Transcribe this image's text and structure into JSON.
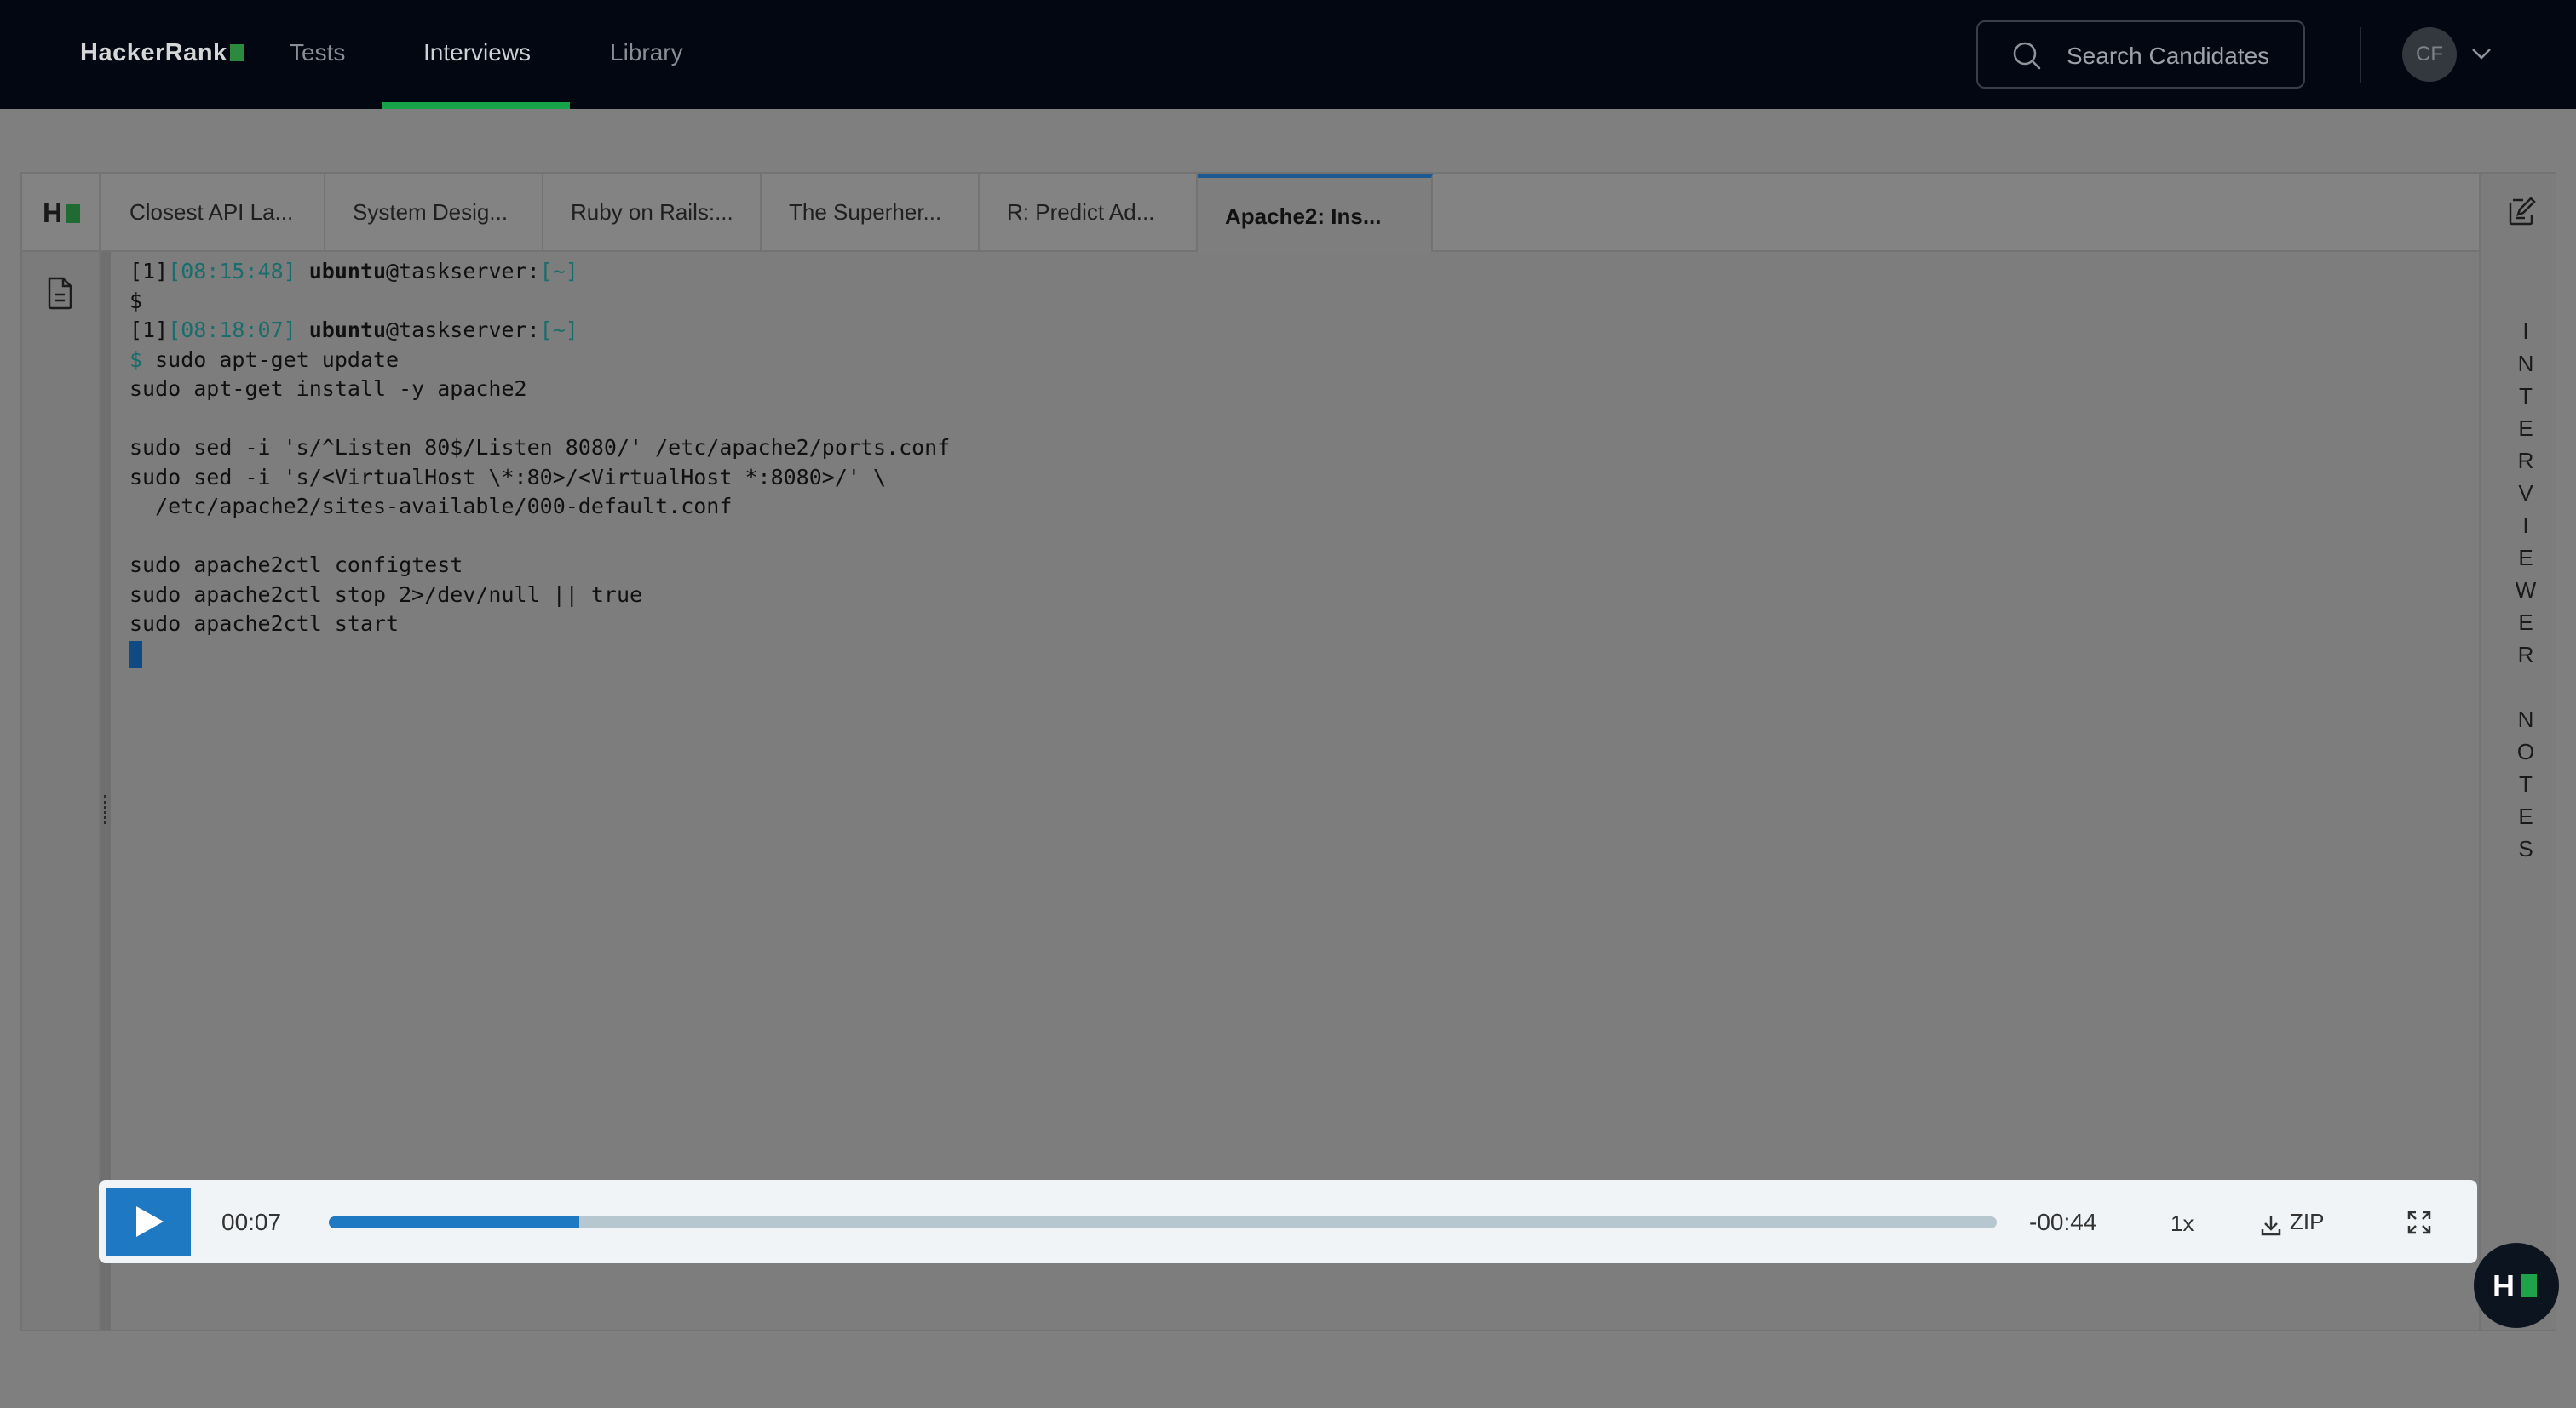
{
  "nav": {
    "logo": "HackerRank",
    "items": [
      {
        "label": "Tests"
      },
      {
        "label": "Interviews"
      },
      {
        "label": "Library"
      }
    ],
    "search_label": "Search Candidates",
    "avatar_initials": "CF"
  },
  "tabs": [
    {
      "label": "Closest API La..."
    },
    {
      "label": "System Desig..."
    },
    {
      "label": "Ruby on Rails:..."
    },
    {
      "label": "The Superher..."
    },
    {
      "label": "R: Predict Ad..."
    },
    {
      "label": "Apache2: Ins..."
    }
  ],
  "notes_label": "INTERVIEWER NOTES",
  "terminal": {
    "prompt1_index": "[1]",
    "prompt1_time": "[08:15:48]",
    "prompt1_user": "ubuntu",
    "prompt1_host": "@taskserver:",
    "prompt1_path": "[~]",
    "prompt1_symbol": "$",
    "prompt2_index": "[1]",
    "prompt2_time": "[08:18:07]",
    "prompt2_user": "ubuntu",
    "prompt2_host": "@taskserver:",
    "prompt2_path": "[~]",
    "prompt2_symbol": "$",
    "lines": [
      "sudo apt-get update",
      "sudo apt-get install -y apache2",
      "",
      "sudo sed -i 's/^Listen 80$/Listen 8080/' /etc/apache2/ports.conf",
      "sudo sed -i 's/<VirtualHost \\*:80>/<VirtualHost *:8080>/' \\",
      "  /etc/apache2/sites-available/000-default.conf",
      "",
      "sudo apache2ctl configtest",
      "sudo apache2ctl stop 2>/dev/null || true",
      "sudo apache2ctl start"
    ]
  },
  "player": {
    "current_time": "00:07",
    "remaining_time": "-00:44",
    "progress": 0.15,
    "speed": "1x",
    "download_label": "ZIP"
  },
  "colors": {
    "accent": "#1e78c2",
    "nav_active": "#16a34a",
    "topbar": "#030712"
  }
}
